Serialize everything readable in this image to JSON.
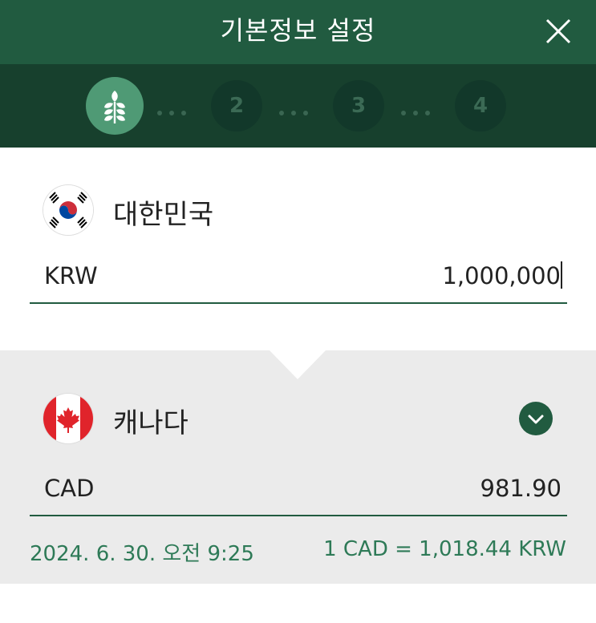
{
  "header": {
    "title": "기본정보 설정",
    "close_icon": "close-icon"
  },
  "steps": {
    "items": [
      {
        "label": "",
        "icon": "wheat-icon",
        "active": true
      },
      {
        "label": "2",
        "active": false
      },
      {
        "label": "3",
        "active": false
      },
      {
        "label": "4",
        "active": false
      }
    ]
  },
  "from": {
    "country": "대한민국",
    "flag_icon": "korea-flag-icon",
    "currency": "KRW",
    "amount": "1,000,000"
  },
  "to": {
    "country": "캐나다",
    "flag_icon": "canada-flag-icon",
    "currency": "CAD",
    "amount": "981.90",
    "dropdown_icon": "chevron-down-icon"
  },
  "rate_info": {
    "timestamp": "2024. 6. 30. 오전 9:25",
    "rate": "1 CAD = 1,018.44 KRW"
  },
  "colors": {
    "header": "#215b40",
    "steps_bar": "#17402d",
    "active_step": "#4f9a75",
    "accent_text": "#2e7a57",
    "panel_gray": "#ebebeb"
  }
}
